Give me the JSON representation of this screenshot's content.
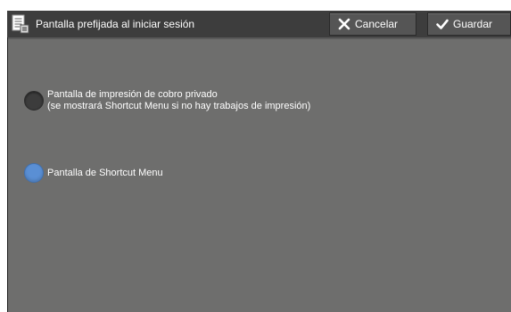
{
  "header": {
    "title": "Pantalla prefijada al iniciar sesión",
    "title_icon": "document-settings-icon",
    "cancel_label": "Cancelar",
    "cancel_icon": "x-icon",
    "save_label": "Guardar",
    "save_icon": "check-icon"
  },
  "options": [
    {
      "line1": "Pantalla de impresión de cobro privado",
      "line2": "(se mostrará Shortcut Menu si no hay trabajos de impresión)",
      "selected": false
    },
    {
      "line1": "Pantalla de Shortcut Menu",
      "selected": true
    }
  ],
  "colors": {
    "header_bg": "#3d3d3d",
    "panel_bg": "#6e6e6d",
    "radio_selected": "#5a8fd4",
    "radio_unselected": "#3c3c3c",
    "text": "#ffffff"
  }
}
